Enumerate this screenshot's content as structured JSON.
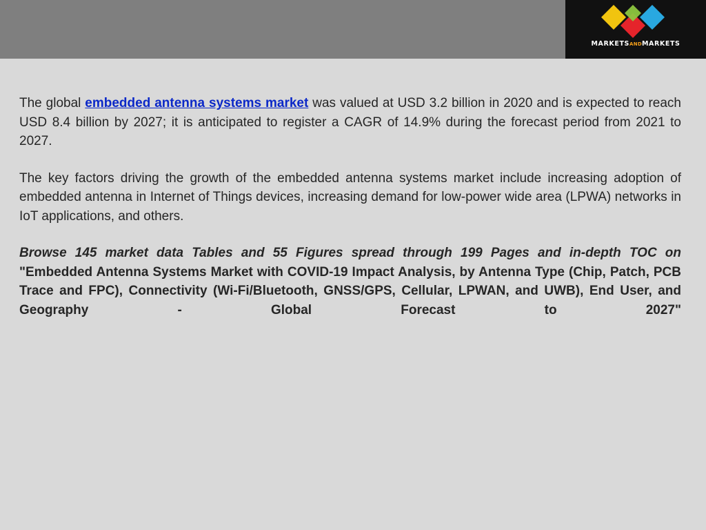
{
  "logo": {
    "text_left": "MARKETS",
    "text_mid": "AND",
    "text_right": "MARKETS",
    "colors": {
      "yellow": "#f1c40f",
      "blue": "#29a8e0",
      "red": "#e5242b",
      "green": "#8dc63f"
    }
  },
  "paragraph1": {
    "before": "The global ",
    "link": "embedded antenna systems market",
    "after": " was valued at USD 3.2 billion in 2020 and is expected to reach USD 8.4 billion by 2027; it is anticipated to register a CAGR of 14.9% during the forecast period from 2021 to 2027."
  },
  "paragraph2": "The key factors driving the growth of the embedded antenna systems market include increasing adoption of embedded antenna in Internet of Things devices, increasing demand for low-power wide area (LPWA) networks in IoT applications, and others.",
  "paragraph3": {
    "lead": "Browse 145 market data Tables and 55 Figures spread through 199 Pages and in-depth TOC on",
    "title": " \"Embedded Antenna Systems Market with COVID-19 Impact Analysis, by Antenna Type (Chip, Patch, PCB Trace and FPC), Connectivity (Wi-Fi/Bluetooth, GNSS/GPS, Cellular, LPWAN, and UWB), End User, and Geography - Global Forecast to 2027\""
  }
}
